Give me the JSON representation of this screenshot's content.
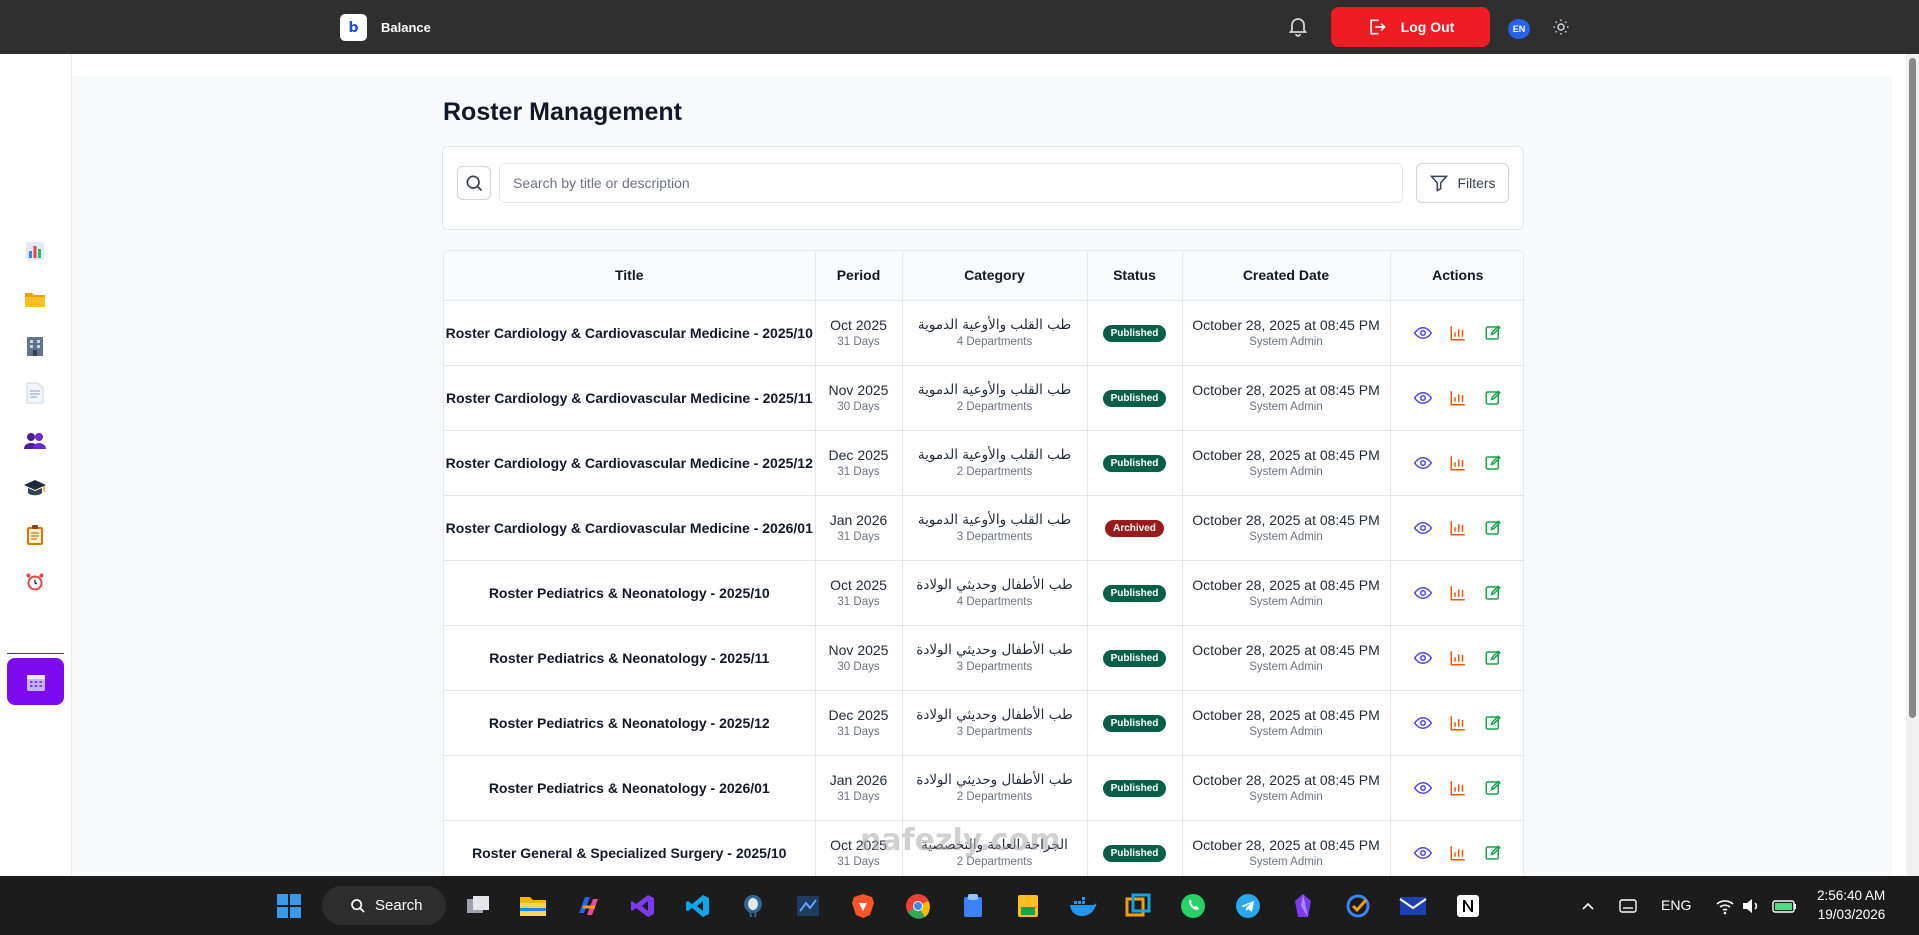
{
  "app": {
    "brand_logo_text": "b",
    "brand_name": "Balance"
  },
  "topbar": {
    "logout_label": "Log Out",
    "language_badge": "EN"
  },
  "page": {
    "title": "Roster Management"
  },
  "search": {
    "placeholder": "Search by title or description",
    "value": "",
    "filters_label": "Filters"
  },
  "table": {
    "headers": {
      "title": "Title",
      "period": "Period",
      "category": "Category",
      "status": "Status",
      "created": "Created Date",
      "actions": "Actions"
    },
    "rows": [
      {
        "title": "Roster Cardiology & Cardiovascular Medicine - 2025/10",
        "period": "Oct 2025",
        "days": "31 Days",
        "category": "طب القلب والأوعية الدموية",
        "departments": "4 Departments",
        "status": "Published",
        "created": "October 28, 2025 at 08:45 PM",
        "created_by": "System Admin"
      },
      {
        "title": "Roster Cardiology & Cardiovascular Medicine - 2025/11",
        "period": "Nov 2025",
        "days": "30 Days",
        "category": "طب القلب والأوعية الدموية",
        "departments": "2 Departments",
        "status": "Published",
        "created": "October 28, 2025 at 08:45 PM",
        "created_by": "System Admin"
      },
      {
        "title": "Roster Cardiology & Cardiovascular Medicine - 2025/12",
        "period": "Dec 2025",
        "days": "31 Days",
        "category": "طب القلب والأوعية الدموية",
        "departments": "2 Departments",
        "status": "Published",
        "created": "October 28, 2025 at 08:45 PM",
        "created_by": "System Admin"
      },
      {
        "title": "Roster Cardiology & Cardiovascular Medicine - 2026/01",
        "period": "Jan 2026",
        "days": "31 Days",
        "category": "طب القلب والأوعية الدموية",
        "departments": "3 Departments",
        "status": "Archived",
        "created": "October 28, 2025 at 08:45 PM",
        "created_by": "System Admin"
      },
      {
        "title": "Roster Pediatrics & Neonatology - 2025/10",
        "period": "Oct 2025",
        "days": "31 Days",
        "category": "طب الأطفال وحديثي الولادة",
        "departments": "4 Departments",
        "status": "Published",
        "created": "October 28, 2025 at 08:45 PM",
        "created_by": "System Admin"
      },
      {
        "title": "Roster Pediatrics & Neonatology - 2025/11",
        "period": "Nov 2025",
        "days": "30 Days",
        "category": "طب الأطفال وحديثي الولادة",
        "departments": "3 Departments",
        "status": "Published",
        "created": "October 28, 2025 at 08:45 PM",
        "created_by": "System Admin"
      },
      {
        "title": "Roster Pediatrics & Neonatology - 2025/12",
        "period": "Dec 2025",
        "days": "31 Days",
        "category": "طب الأطفال وحديثي الولادة",
        "departments": "3 Departments",
        "status": "Published",
        "created": "October 28, 2025 at 08:45 PM",
        "created_by": "System Admin"
      },
      {
        "title": "Roster Pediatrics & Neonatology - 2026/01",
        "period": "Jan 2026",
        "days": "31 Days",
        "category": "طب الأطفال وحديثي الولادة",
        "departments": "2 Departments",
        "status": "Published",
        "created": "October 28, 2025 at 08:45 PM",
        "created_by": "System Admin"
      },
      {
        "title": "Roster General & Specialized Surgery - 2025/10",
        "period": "Oct 2025",
        "days": "31 Days",
        "category": "الجراحة العامة والتخصصية",
        "departments": "2 Departments",
        "status": "Published",
        "created": "October 28, 2025 at 08:45 PM",
        "created_by": "System Admin"
      }
    ]
  },
  "sidebar": {
    "items": [
      {
        "icon": "chart-icon"
      },
      {
        "icon": "folder-icon"
      },
      {
        "icon": "building-icon"
      },
      {
        "icon": "document-icon"
      },
      {
        "icon": "users-icon"
      },
      {
        "icon": "graduation-cap-icon"
      },
      {
        "icon": "clipboard-icon"
      },
      {
        "icon": "alarm-clock-icon"
      },
      {
        "icon": "calendar-icon",
        "active": true
      }
    ]
  },
  "taskbar": {
    "search_label": "Search",
    "language": "ENG",
    "time": "2:56:40 AM",
    "date": "19/03/2026",
    "watermark": "nafezly.com"
  },
  "colors": {
    "logout": "#ef1c24",
    "sidebar_active": "#7c0bf0",
    "published": "#065f46",
    "archived": "#991b1b",
    "view_icon": "#4f46e5",
    "stats_icon": "#ea580c",
    "edit_icon": "#16a34a"
  }
}
